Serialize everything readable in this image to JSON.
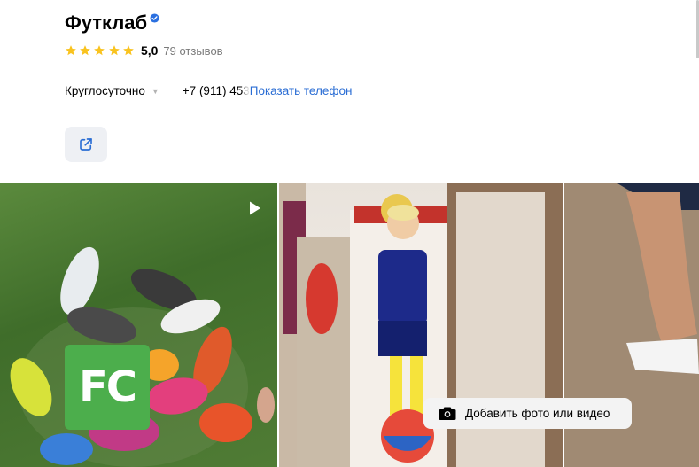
{
  "org": {
    "name": "Футклаб",
    "rating": "5,0",
    "stars_filled": 5,
    "reviews": "79 отзывов",
    "hours": "Круглосуточно",
    "phone_partial": "+7 (911) 45",
    "phone_hidden_tail": "3",
    "show_phone": "Показать телефон"
  },
  "icons": {
    "verified": "verified-badge-icon",
    "star": "star-icon",
    "share": "external-link-icon",
    "play": "play-icon",
    "camera": "camera-icon"
  },
  "colors": {
    "star": "#f9c31f",
    "link": "#2a6dd4",
    "verified": "#2b70e0",
    "logo_bg": "#4cae4c"
  },
  "gallery": {
    "logo_text": "FC",
    "add_media_label": "Добавить фото или видео"
  }
}
